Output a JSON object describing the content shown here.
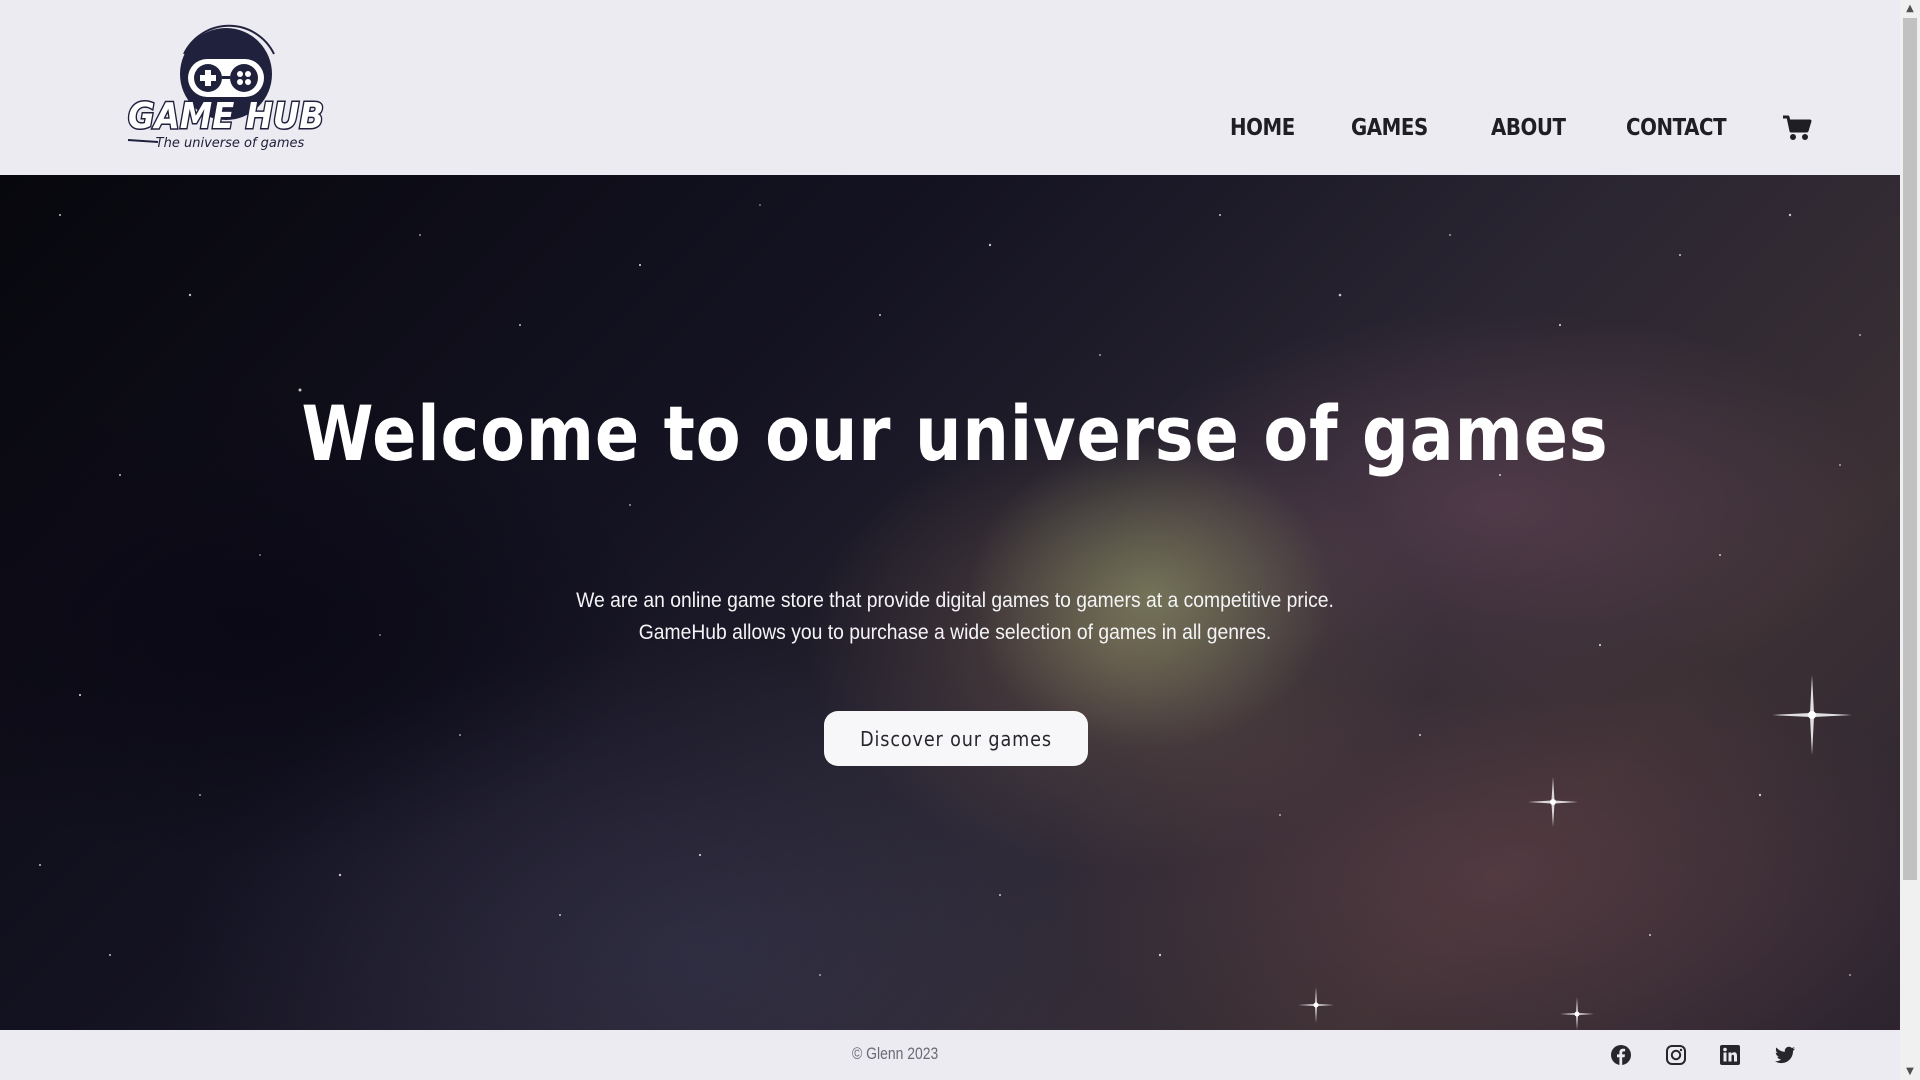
{
  "logo": {
    "title": "GAME HUB",
    "tagline": "The universe of games"
  },
  "nav": {
    "items": [
      {
        "label": "HOME"
      },
      {
        "label": "GAMES"
      },
      {
        "label": "ABOUT"
      },
      {
        "label": "CONTACT"
      }
    ],
    "cart_icon": "shopping-cart-icon"
  },
  "hero": {
    "title": "Welcome to our universe of games",
    "text": "We are an online game store that provide digital games to gamers at a competitive price. GameHub allows you to purchase a wide selection of games in all genres.",
    "button_label": "Discover our games"
  },
  "footer": {
    "copyright": "© Glenn 2023",
    "social": [
      {
        "icon": "facebook-icon"
      },
      {
        "icon": "instagram-icon"
      },
      {
        "icon": "linkedin-icon"
      },
      {
        "icon": "twitter-icon"
      }
    ]
  },
  "colors": {
    "header_bg": "#ecebf1",
    "nav_text": "#1e1e24",
    "hero_text": "#ffffff",
    "button_bg": "#f7f7f9",
    "logo_dark": "#20213d"
  }
}
